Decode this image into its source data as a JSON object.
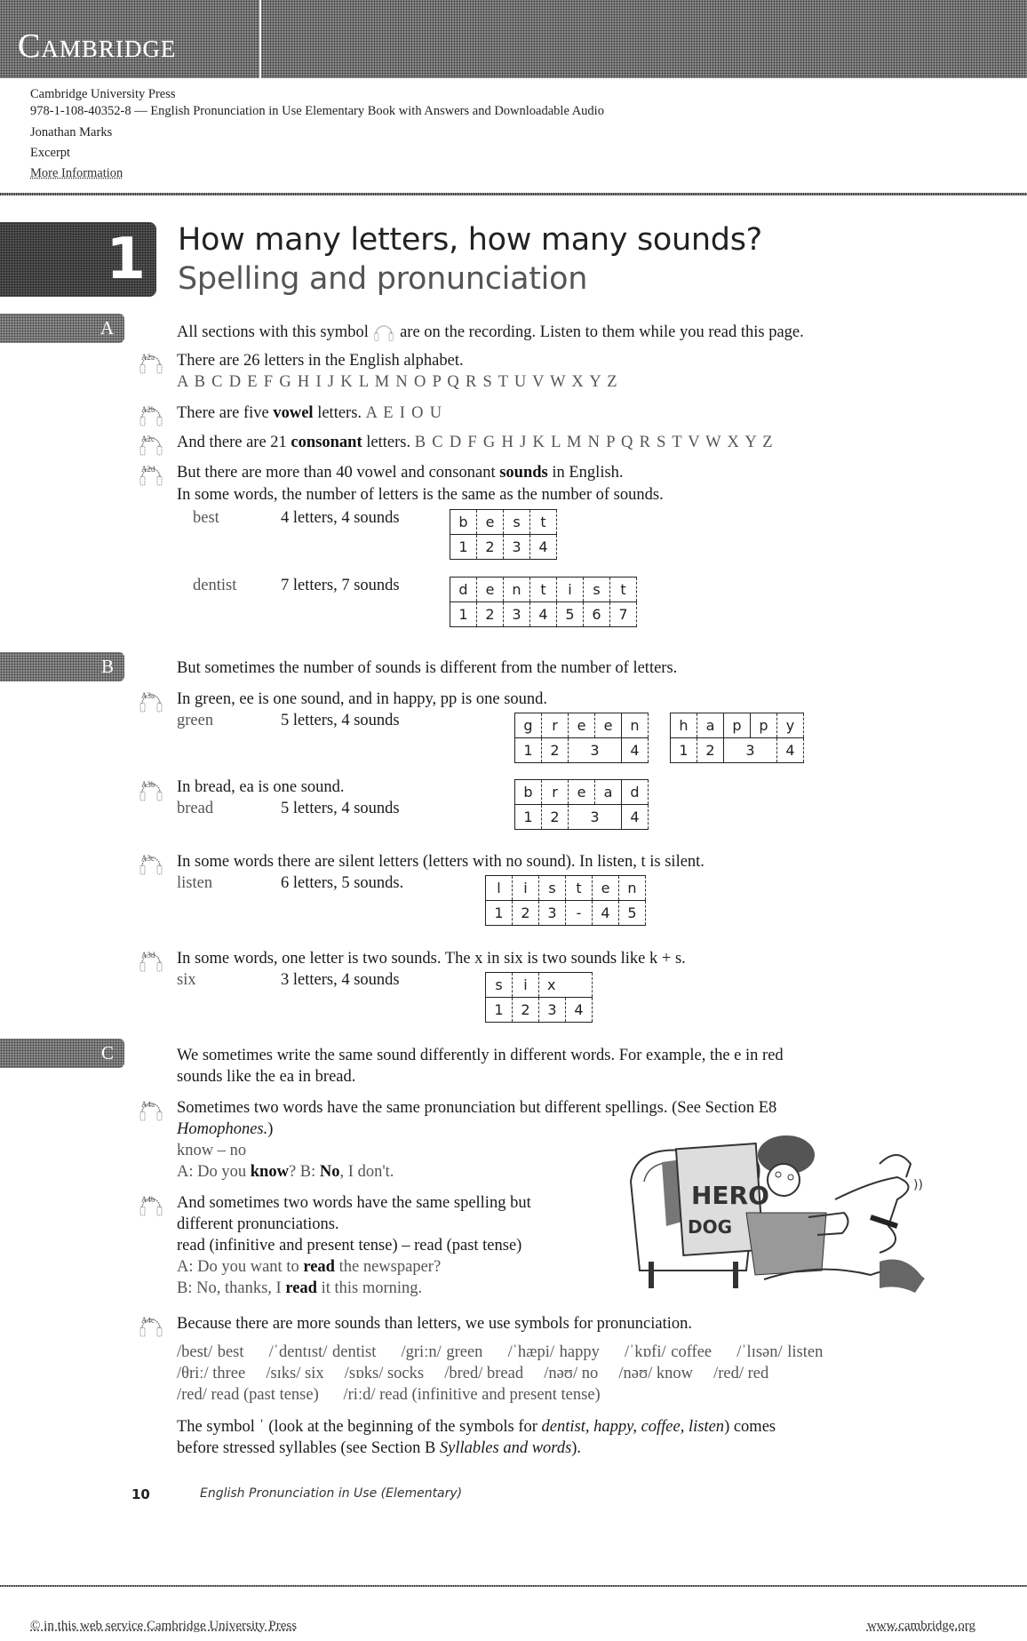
{
  "header": {
    "brand": "Cambridge",
    "publisher": "Cambridge University Press",
    "isbn_title": "978-1-108-40352-8 — English Pronunciation in Use Elementary Book with Answers and Downloadable Audio",
    "author": "Jonathan Marks",
    "excerpt": "Excerpt",
    "more_info": "More Information"
  },
  "chapter": {
    "number": "1",
    "title": "How many letters, how many sounds?",
    "subtitle": "Spelling and pronunciation"
  },
  "sections": {
    "A": {
      "tab": "A",
      "intro_before": "All sections with this symbol",
      "intro_after": "are on the recording. Listen to them while you read this page.",
      "items": [
        {
          "track": "A2a",
          "text": "There are 26 letters in the English alphabet.",
          "extra": "A B C D E F G H I J K L M N O P Q R S T U V W X Y Z"
        },
        {
          "track": "A2b",
          "text_pre": "There are five ",
          "bold": "vowel",
          "text_post": " letters.",
          "extra": "A E I O U"
        },
        {
          "track": "A2c",
          "text_pre": "And there are 21 ",
          "bold": "consonant",
          "text_post": " letters.",
          "extra": "B C D F G H J K L M N P Q R S T V W X Y Z"
        },
        {
          "track": "A2d",
          "text_pre": "But there are more than 40 vowel and consonant ",
          "bold": "sounds",
          "text_post": " in English.",
          "line2": "In some words, the number of letters is the same as the number of sounds."
        }
      ],
      "examples": [
        {
          "word": "best",
          "desc": "4 letters, 4 sounds",
          "letters": [
            "b",
            "e",
            "s",
            "t"
          ],
          "sounds": [
            "1",
            "2",
            "3",
            "4"
          ]
        },
        {
          "word": "dentist",
          "desc": "7 letters, 7 sounds",
          "letters": [
            "d",
            "e",
            "n",
            "t",
            "i",
            "s",
            "t"
          ],
          "sounds": [
            "1",
            "2",
            "3",
            "4",
            "5",
            "6",
            "7"
          ]
        }
      ]
    },
    "B": {
      "tab": "B",
      "intro": "But sometimes the number of sounds is different from the number of letters.",
      "items": [
        {
          "track": "A3a",
          "text": "In green, ee is one sound, and in happy, pp is one sound.",
          "word": "green",
          "desc": "5 letters, 4 sounds",
          "tables": [
            {
              "letters": [
                "g",
                "r",
                "e",
                "e",
                "n"
              ],
              "sounds": [
                "1",
                "2",
                "3",
                "4"
              ]
            },
            {
              "letters": [
                "h",
                "a",
                "p",
                "p",
                "y"
              ],
              "sounds": [
                "1",
                "2",
                "3",
                "4"
              ]
            }
          ]
        },
        {
          "track": "A3b",
          "text": "In bread, ea is one sound.",
          "word": "bread",
          "desc": "5 letters, 4 sounds",
          "tables": [
            {
              "letters": [
                "b",
                "r",
                "e",
                "a",
                "d"
              ],
              "sounds": [
                "1",
                "2",
                "3",
                "4"
              ]
            }
          ]
        },
        {
          "track": "A3c",
          "text": "In some words there are silent letters (letters with no sound). In listen, t is silent.",
          "word": "listen",
          "desc": "6 letters, 5 sounds.",
          "tables": [
            {
              "letters": [
                "l",
                "i",
                "s",
                "t",
                "e",
                "n"
              ],
              "sounds": [
                "1",
                "2",
                "3",
                "-",
                "4",
                "5"
              ]
            }
          ]
        },
        {
          "track": "A3d",
          "text": "In some words, one letter is two sounds. The x in six is two sounds like k + s.",
          "word": "six",
          "desc": "3 letters, 4 sounds",
          "tables": [
            {
              "letters": [
                "s",
                "i",
                "x"
              ],
              "sounds": [
                "1",
                "2",
                "3",
                "4"
              ]
            }
          ]
        }
      ]
    },
    "C": {
      "tab": "C",
      "intro_line1": "We sometimes write the same sound differently in different words. For example, the e in red",
      "intro_line2": "sounds like the ea in bread.",
      "a4a": {
        "track": "A4a",
        "line1": "Sometimes two words have the same pronunciation but different spellings. (See Section E8",
        "line2_italic": "Homophones.",
        "line2_end": ")",
        "pair": "know – no",
        "dialog_a": "A: Do you ",
        "dialog_a_bold": "know",
        "dialog_b": "? B: ",
        "dialog_b_bold": "No",
        "dialog_end": ", I don't."
      },
      "a4b": {
        "track": "A4b",
        "line1": "And sometimes two words have the same spelling but",
        "line2": "different pronunciations.",
        "line3": "read (infinitive and present tense) – read (past tense)",
        "line4_pre": "A: Do you want to ",
        "line4_bold": "read",
        "line4_post": " the newspaper?",
        "line5_pre": "B: No, thanks, I ",
        "line5_bold": "read",
        "line5_post": " it this morning."
      },
      "a4c": {
        "track": "A4c",
        "text": "Because there are more sounds than letters, we use symbols for pronunciation.",
        "symbols_row1": [
          "/best/ best",
          "/ˈdentɪst/ dentist",
          "/griːn/ green",
          "/ˈhæpi/ happy",
          "/ˈkɒfi/ coffee",
          "/ˈlɪsən/ listen"
        ],
        "symbols_row2": [
          "/θriː/ three",
          "/sɪks/ six",
          "/sɒks/ socks",
          "/bred/ bread",
          "/nəʊ/ no",
          "/nəʊ/ know",
          "/red/ red"
        ],
        "symbols_row3": [
          "/red/ read (past tense)",
          "/riːd/ read (infinitive and present tense)"
        ],
        "note_pre": "The symbol ˈ (look at the beginning of the symbols for ",
        "note_italic": "dentist, happy, coffee, listen",
        "note_post": ") comes",
        "note_line2_pre": "before stressed syllables (see Section B ",
        "note_line2_italic": "Syllables and words",
        "note_line2_post": ")."
      },
      "illustration": {
        "newspaper_headline": "HERO DOG"
      }
    }
  },
  "footer": {
    "page_number": "10",
    "book_title": "English Pronunciation in Use (Elementary)",
    "copyright": "© in this web service Cambridge University Press",
    "website": "www.cambridge.org"
  }
}
